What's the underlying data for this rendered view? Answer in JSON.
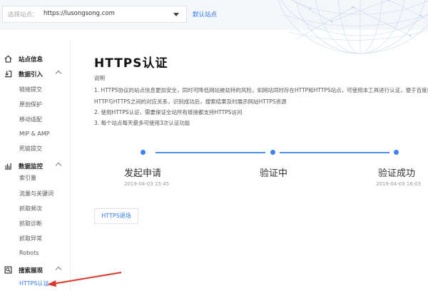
{
  "topbar": {
    "select_label": "选择站点：",
    "site_url": "https://lusongsong.com",
    "default_site": "默认站点"
  },
  "sidebar": {
    "sections": [
      {
        "label": "站点信息",
        "icon": "home-icon",
        "items": []
      },
      {
        "label": "数据引入",
        "icon": "download-icon",
        "items": [
          "链接提交",
          "原创保护",
          "移动适配",
          "MIP & AMP",
          "死链提交"
        ]
      },
      {
        "label": "数据监控",
        "icon": "chart-icon",
        "items": [
          "索引量",
          "流量与关键词",
          "抓取频次",
          "抓取诊断",
          "抓取异常",
          "Robots"
        ]
      },
      {
        "label": "搜索展现",
        "icon": "search-display-icon",
        "items": [
          "HTTPS认证"
        ]
      }
    ],
    "active_item": "HTTPS认证"
  },
  "main": {
    "title": "HTTPS认证",
    "desc_title": "说明",
    "desc_lines": [
      "1. HTTPS协议的站点信息更加安全，同时可降低网站被劫持的风险，如网站同时存在HTTP和HTTPS站点，可使用本工具进行认证，便于百度搜索",
      "HTTP与HTTPS之间的对应关系，识别成功后，搜索结果及时展示网站HTTPS资源",
      "2. 使用HTTPS认证，需要保证全站所有链接都支持HTTPS访问",
      "3. 每个站点每天最多可使用3次认证功能"
    ],
    "steps": [
      {
        "label": "发起申请",
        "time": "2019-04-03 15:45"
      },
      {
        "label": "验证中",
        "time": ""
      },
      {
        "label": "验证成功",
        "time": "2019-04-03 16:03"
      }
    ],
    "https_button": "HTTPS退场"
  },
  "colors": {
    "accent": "#2f7cf0",
    "arrow": "#e0342a"
  }
}
